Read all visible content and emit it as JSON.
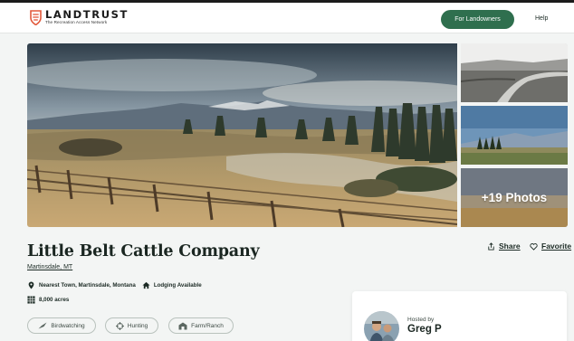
{
  "brand": {
    "name": "LANDTRUST",
    "tagline": "The Recreation Access Network",
    "accent": "#e2583a"
  },
  "nav": {
    "for_landowners": "For Landowners",
    "help": "Help",
    "button_color": "#2f6f4e"
  },
  "gallery": {
    "more_photos": "+19 Photos"
  },
  "listing": {
    "title": "Little Belt Cattle Company",
    "location": "Martinsdale, MT",
    "nearest_town": "Nearest Town, Martinsdale, Montana",
    "lodging": "Lodging Available",
    "acres": "8,000 acres"
  },
  "actions": {
    "share": "Share",
    "favorite": "Favorite"
  },
  "tags": [
    {
      "label": "Birdwatching",
      "icon": "bird-icon"
    },
    {
      "label": "Hunting",
      "icon": "crosshair-icon"
    },
    {
      "label": "Farm/Ranch",
      "icon": "barn-icon"
    }
  ],
  "host": {
    "hosted_by": "Hosted by",
    "name": "Greg P"
  }
}
